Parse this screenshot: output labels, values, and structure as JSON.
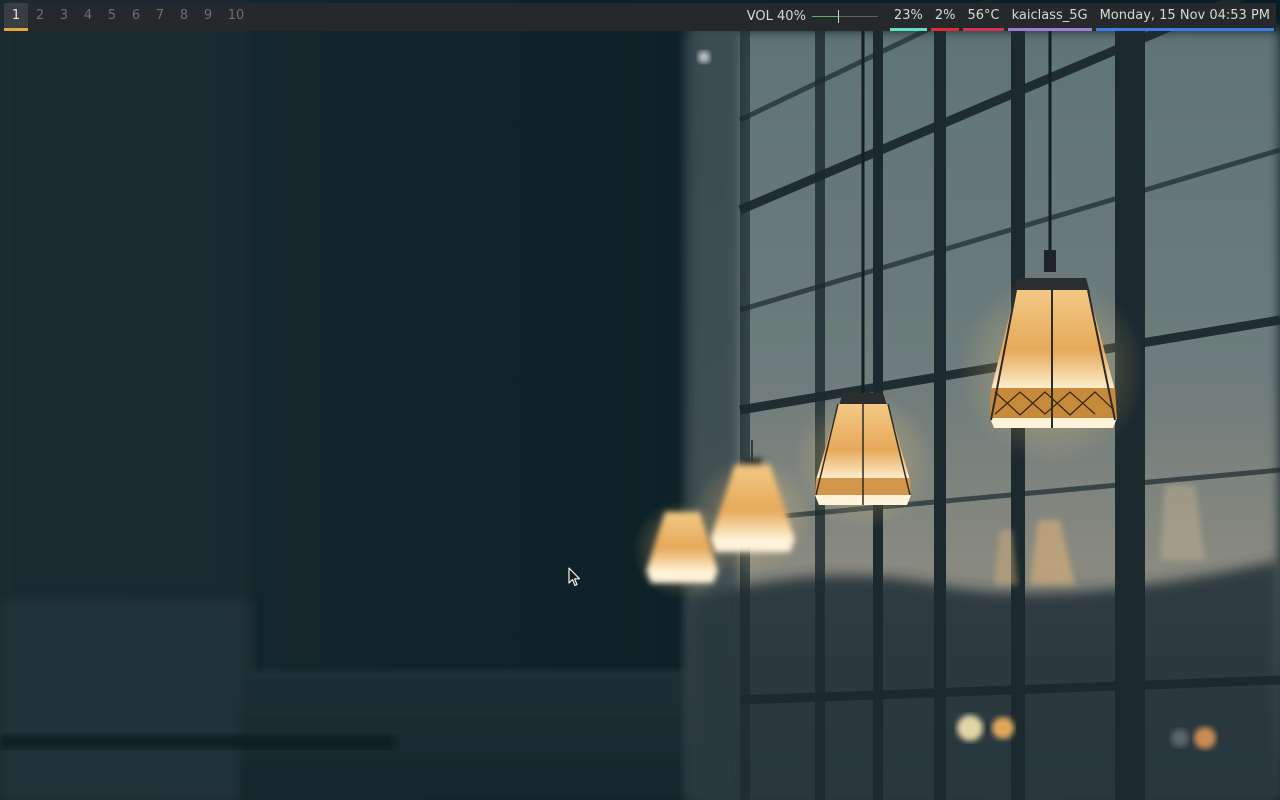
{
  "workspaces": [
    "1",
    "2",
    "3",
    "4",
    "5",
    "6",
    "7",
    "8",
    "9",
    "10"
  ],
  "active_workspace": "1",
  "volume": {
    "label": "VOL 40%",
    "level": 0.4
  },
  "modules": {
    "cpu": {
      "text": "23%",
      "color": "#5ee0c4"
    },
    "mem": {
      "text": "2%",
      "color": "#e02a34"
    },
    "temp": {
      "text": "56°C",
      "color": "#d8325a"
    },
    "wifi": {
      "text": "kaiclass_5G",
      "color": "#9d7fd6"
    },
    "clock": {
      "text": "Monday, 15 Nov 04:53 PM",
      "color": "#3b7de0"
    }
  },
  "accent_active_workspace": "#e5a83b",
  "pointer_icon": "mouse-pointer-icon"
}
